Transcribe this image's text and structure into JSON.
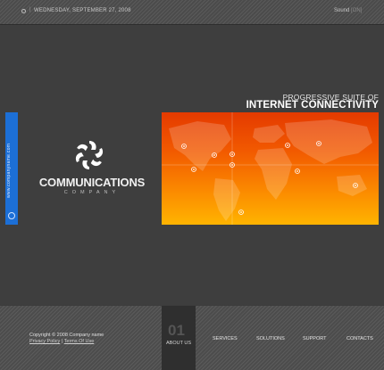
{
  "topbar": {
    "date": "WEDNESDAY, SEPTEMBER 27, 2008",
    "sound_label": "Sound",
    "sound_value": "[ON]"
  },
  "sidetab": {
    "vertical_text": "www.companyname.com"
  },
  "logo": {
    "name": "COMMUNICATIONS",
    "subtitle": "COMPANY"
  },
  "hero": {
    "line1": "PROGRESSIVE SUITE OF",
    "line2": "INTERNET CONNECTIVITY"
  },
  "footer": {
    "copyright": "Copyright © 2008 Company name",
    "privacy": "Privacy Policy",
    "divider": "|",
    "terms": "Terms Of Use",
    "active_number": "01",
    "active_label": "ABOUT US",
    "nav": [
      "SERVICES",
      "SOLUTIONS",
      "SUPPORT",
      "CONTACTS"
    ]
  },
  "colors": {
    "accent_blue": "#1c6fd6",
    "map_orange_top": "#e43a00",
    "map_orange_bottom": "#ffb400",
    "background": "#3e3e3e"
  }
}
